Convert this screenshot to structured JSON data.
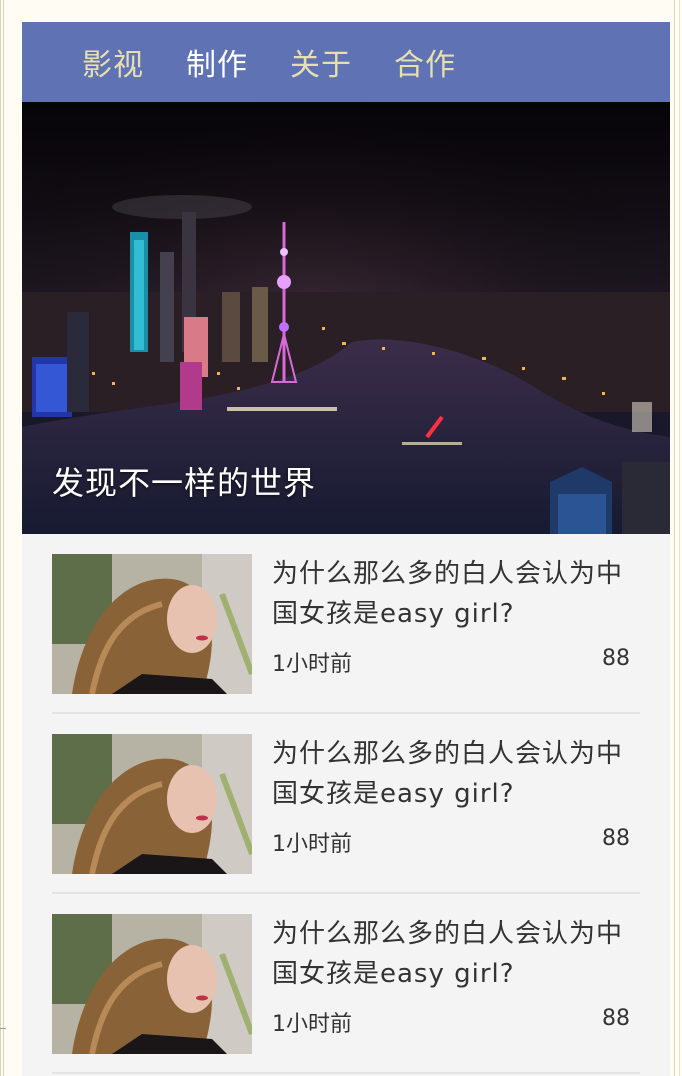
{
  "nav": {
    "items": [
      {
        "label": "影视",
        "active": false
      },
      {
        "label": "制作",
        "active": true
      },
      {
        "label": "关于",
        "active": false
      },
      {
        "label": "合作",
        "active": false
      }
    ],
    "bg_color": "#5f73b4",
    "item_color": "#e7dfae",
    "active_color": "#ffffff"
  },
  "hero": {
    "caption": "发现不一样的世界",
    "image": "night-city-skyline-photo"
  },
  "articles": [
    {
      "title": "为什么那么多的白人会认为中国女孩是easy girl?",
      "time": "1小时前",
      "count": "88",
      "image": "girl-portrait-photo"
    },
    {
      "title": "为什么那么多的白人会认为中国女孩是easy girl?",
      "time": "1小时前",
      "count": "88",
      "image": "girl-portrait-photo"
    },
    {
      "title": "为什么那么多的白人会认为中国女孩是easy girl?",
      "time": "1小时前",
      "count": "88",
      "image": "girl-portrait-photo"
    }
  ]
}
